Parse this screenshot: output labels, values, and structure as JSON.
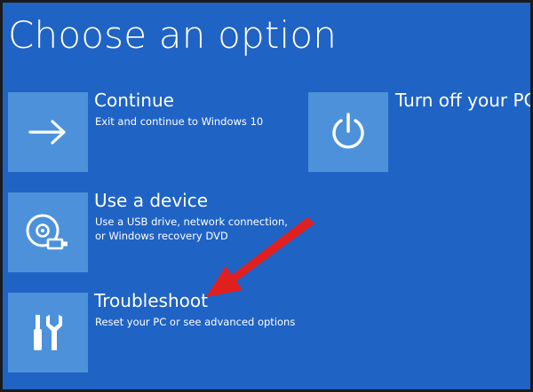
{
  "screen": {
    "title": "Choose an option"
  },
  "options": {
    "continue": {
      "label": "Continue",
      "description_lines": [
        "Exit and continue to Windows 10"
      ],
      "icon": "arrow-right-icon"
    },
    "use_device": {
      "label": "Use a device",
      "description_lines": [
        "Use a USB drive, network connection,",
        "or Windows recovery DVD"
      ],
      "icon": "disc-drive-icon"
    },
    "troubleshoot": {
      "label": "Troubleshoot",
      "description_lines": [
        "Reset your PC or see advanced options"
      ],
      "icon": "tools-icon"
    },
    "turn_off": {
      "label": "Turn off your PC",
      "description_lines": [],
      "icon": "power-icon"
    }
  },
  "annotation": {
    "icon": "red-arrow-icon",
    "color": "#e01f1f"
  },
  "colors": {
    "background": "#1f63c4",
    "tile": "#4d91da",
    "text": "#ffffff"
  }
}
